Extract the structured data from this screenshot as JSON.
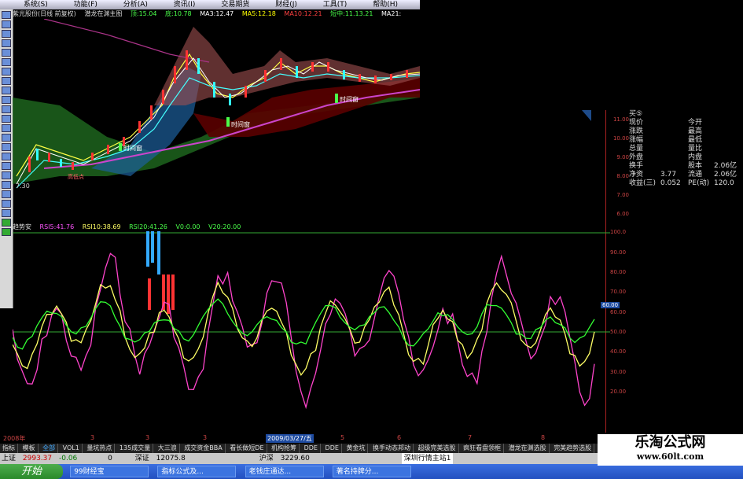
{
  "menubar": {
    "items": [
      "系统(S)",
      "功能(F)",
      "分析(A)",
      "资讯(I)",
      "交易期货",
      "财经(J)",
      "工具(T)",
      "帮助(H)"
    ]
  },
  "topinfo": {
    "stock": "紫光股份(日线 前复权)",
    "indicator": "潜龙在渊主图",
    "items": [
      {
        "text": "顶:15.04",
        "color": "#4aff4a"
      },
      {
        "text": "底:10.78",
        "color": "#4aff4a"
      },
      {
        "text": "MA3:12.47",
        "color": "#fff"
      },
      {
        "text": "MA5:12.18",
        "color": "#ffff00"
      },
      {
        "text": "MA10:12.21",
        "color": "#ff4040"
      },
      {
        "text": "短中:11.13.21",
        "color": "#4aff4a"
      },
      {
        "text": "MA21:",
        "color": "#fff"
      }
    ]
  },
  "mainchart_labels": {
    "low_price": "7.30",
    "time_win1": "时间窗",
    "time_win2": "时间窗",
    "time_win3": "时间窗",
    "bottom_mark": "高低点"
  },
  "price_scale": [
    "11.00",
    "10.00",
    "9.00",
    "8.00",
    "7.00",
    "6.00"
  ],
  "quote": {
    "rows": [
      {
        "k": "现价",
        "v": "",
        "k2": "今开",
        "v2": ""
      },
      {
        "k": "涨跌",
        "v": "",
        "k2": "最高",
        "v2": ""
      },
      {
        "k": "涨幅",
        "v": "",
        "k2": "最低",
        "v2": ""
      },
      {
        "k": "总量",
        "v": "",
        "k2": "量比",
        "v2": ""
      },
      {
        "k": "外盘",
        "v": "",
        "k2": "内盘",
        "v2": ""
      },
      {
        "k": "换手",
        "v": "",
        "k2": "股本",
        "v2": "2.06亿"
      },
      {
        "k": "净资",
        "v": "3.77",
        "k2": "流通",
        "v2": "2.06亿"
      },
      {
        "k": "收益(三)",
        "v": "0.052",
        "k2": "PE(动)",
        "v2": "120.0"
      }
    ],
    "header": "买⑤"
  },
  "indhead": {
    "name": "趋势安",
    "items": [
      {
        "text": "RSI5:41.76",
        "color": "#ff55ff"
      },
      {
        "text": "RSI10:38.69",
        "color": "#ffff66"
      },
      {
        "text": "RSI20:41.26",
        "color": "#4aff4a"
      },
      {
        "text": "V0:0.00",
        "color": "#4aff4a"
      },
      {
        "text": "V20:20.00",
        "color": "#4aff4a"
      }
    ]
  },
  "ind_scale": [
    "100.0",
    "90.00",
    "80.00",
    "70.00",
    "60.00",
    "50.00",
    "40.00",
    "30.00",
    "20.00"
  ],
  "ind_current": "60.00",
  "datebar": {
    "year": "2008年",
    "date": "2009/03/27/五",
    "ticks": [
      "3",
      "3",
      "3",
      "4",
      "5",
      "6",
      "7",
      "8"
    ]
  },
  "tabs": [
    "指标",
    "模板",
    "全部",
    "VOL1",
    "量坑热点",
    "135成交量",
    "大三浪",
    "成交资金BBA",
    "看长做短DE",
    "机构抢筹",
    "DDE",
    "DDE",
    "黄金坑",
    "换手动态邦动",
    "超级完美选股",
    "疯狂看盘领框",
    "潜龙在渊选股",
    "完美趋势选股",
    "德驰"
  ],
  "statusbar": {
    "sh_label": "上证",
    "sh_val": "2993.37",
    "sh_chg": "-0.06",
    "sh_vol": "0",
    "sz_label": "深证",
    "sz_val": "12075.8",
    "hs_label": "沪深",
    "hs_val": "3229.60",
    "server": "深圳行情主站1"
  },
  "taskbar": {
    "start": "开始",
    "tasks": [
      "99财经宝",
      "指标公式及...",
      "老钱庄通达...",
      "著名持牌分..."
    ]
  },
  "watermark": {
    "title": "乐淘公式网",
    "url": "www.60lt.com"
  },
  "colors": {
    "rsi5": "#ff44cc",
    "rsi10": "#ffff66",
    "rsi20": "#33ff33",
    "up": "#ff3333",
    "down": "#33ffff"
  }
}
